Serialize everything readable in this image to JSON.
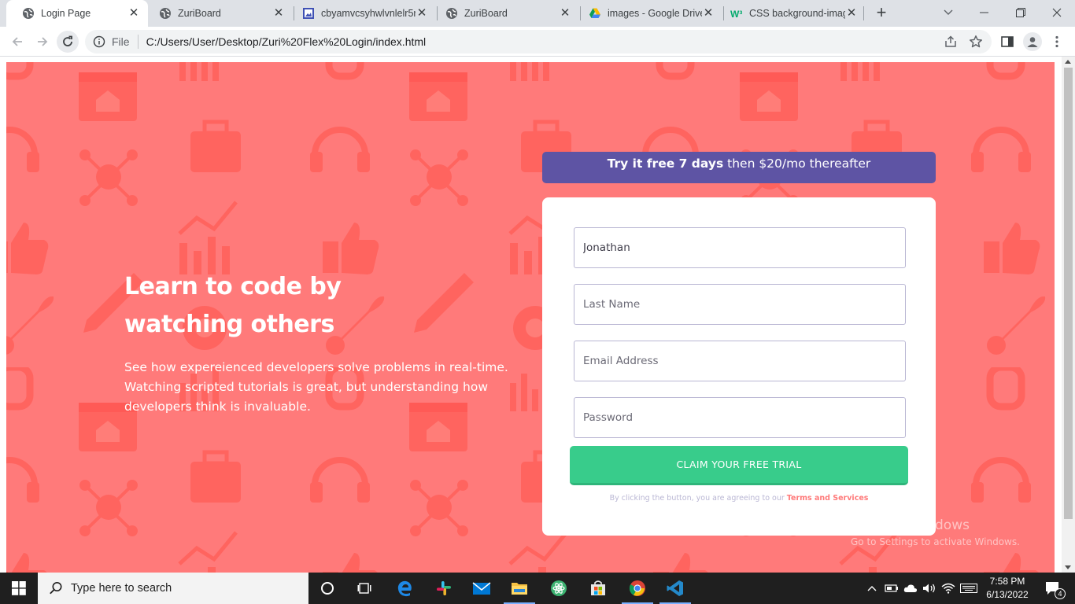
{
  "browser": {
    "tabs": [
      {
        "title": "Login Page",
        "favicon": "globe-icon",
        "active": true
      },
      {
        "title": "ZuriBoard",
        "favicon": "globe-icon",
        "active": false
      },
      {
        "title": "cbyamvcsyhwlvnlelr5r",
        "favicon": "image-file-icon",
        "active": false
      },
      {
        "title": "ZuriBoard",
        "favicon": "globe-icon",
        "active": false
      },
      {
        "title": "images - Google Drive",
        "favicon": "google-drive-icon",
        "active": false
      },
      {
        "title": "CSS background-imag",
        "favicon": "w3schools-icon",
        "active": false
      }
    ],
    "address": {
      "scheme_label": "File",
      "url": "C:/Users/User/Desktop/Zuri%20Flex%20Login/index.html"
    }
  },
  "page": {
    "background_color": "#ff7a7a",
    "headline": "Learn to code by watching others",
    "intro": "See how expereienced developers solve problems in real-time. Watching scripted tutorials is great, but understanding how developers think is invaluable.",
    "banner": {
      "bold": "Try it free 7 days",
      "rest": " then $20/mo thereafter",
      "color": "#5e54a4"
    },
    "form": {
      "first_name_value": "Jonathan",
      "last_name_placeholder": "Last Name",
      "email_placeholder": "Email Address",
      "password_placeholder": "Password",
      "submit_label": "CLAIM YOUR FREE TRIAL",
      "submit_color": "#38cc8b",
      "terms_text": "By clicking the button, you are agreeing to our ",
      "terms_link": "Terms and Services"
    },
    "watermark": {
      "line1": "Activate Windows",
      "line2": "Go to Settings to activate Windows."
    }
  },
  "taskbar": {
    "search_placeholder": "Type here to search",
    "apps": [
      "task-view-icon",
      "edge-icon",
      "slack-icon",
      "mail-icon",
      "file-explorer-icon",
      "atom-icon",
      "store-icon",
      "chrome-icon",
      "vscode-icon"
    ],
    "time": "7:58 PM",
    "date": "6/13/2022",
    "notification_count": "4"
  }
}
